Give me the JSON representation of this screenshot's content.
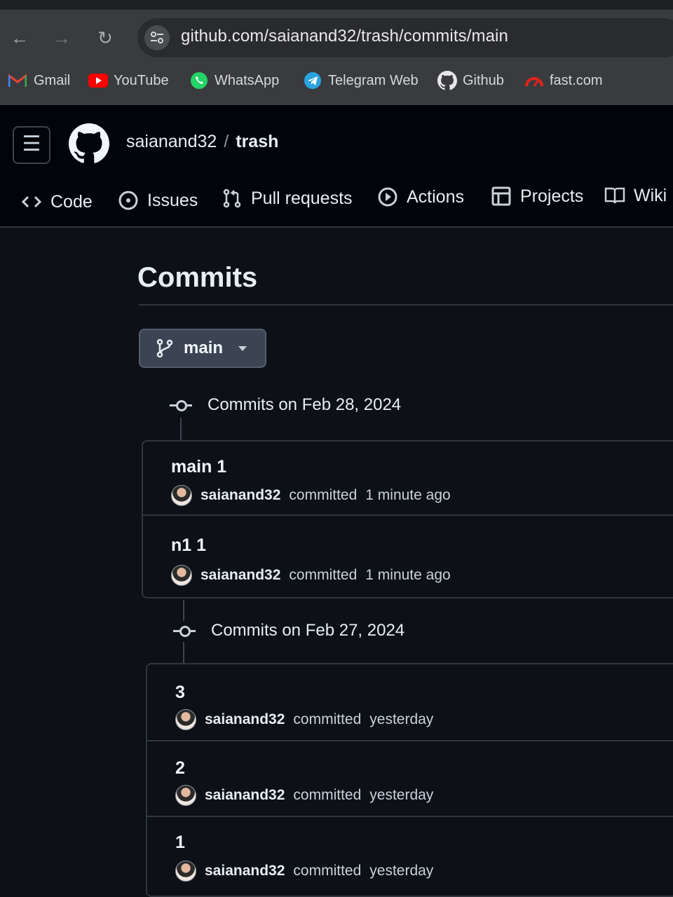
{
  "browser": {
    "url": "github.com/saianand32/trash/commits/main",
    "bookmarks": [
      {
        "label": "Gmail",
        "icon": "gmail-icon"
      },
      {
        "label": "YouTube",
        "icon": "youtube-icon"
      },
      {
        "label": "WhatsApp",
        "icon": "whatsapp-icon"
      },
      {
        "label": "Telegram Web",
        "icon": "telegram-icon"
      },
      {
        "label": "Github",
        "icon": "github-icon"
      },
      {
        "label": "fast.com",
        "icon": "fast-icon"
      }
    ]
  },
  "repo": {
    "owner": "saianand32",
    "separator": "/",
    "name": "trash"
  },
  "tabs": [
    {
      "label": "Code",
      "icon": "code-icon"
    },
    {
      "label": "Issues",
      "icon": "issue-icon"
    },
    {
      "label": "Pull requests",
      "icon": "pull-request-icon"
    },
    {
      "label": "Actions",
      "icon": "play-icon"
    },
    {
      "label": "Projects",
      "icon": "table-icon"
    },
    {
      "label": "Wiki",
      "icon": "book-icon"
    }
  ],
  "main": {
    "title": "Commits",
    "branch": "main",
    "groups": [
      {
        "heading": "Commits on Feb 28, 2024",
        "commits": [
          {
            "title": "main 1",
            "author": "saianand32",
            "action": "committed",
            "time": "1 minute ago"
          },
          {
            "title": "n1 1",
            "author": "saianand32",
            "action": "committed",
            "time": "1 minute ago"
          }
        ]
      },
      {
        "heading": "Commits on Feb 27, 2024",
        "commits": [
          {
            "title": "3",
            "author": "saianand32",
            "action": "committed",
            "time": "yesterday"
          },
          {
            "title": "2",
            "author": "saianand32",
            "action": "committed",
            "time": "yesterday"
          },
          {
            "title": "1",
            "author": "saianand32",
            "action": "committed",
            "time": "yesterday"
          }
        ]
      }
    ]
  },
  "colors": {
    "background": "#0d1117",
    "header": "#010409",
    "border": "#30363d",
    "branch_button": "#3b4452"
  }
}
